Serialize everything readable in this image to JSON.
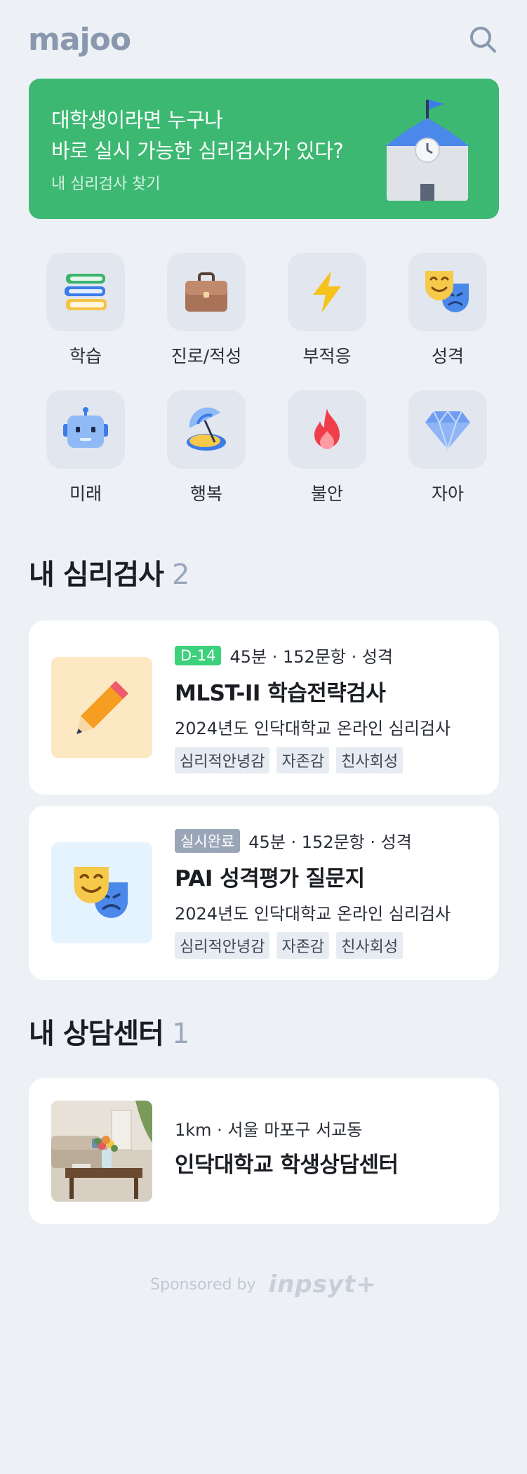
{
  "header": {
    "logo": "majoo",
    "search_icon": "search-icon"
  },
  "banner": {
    "line1": "대학생이라면 누구나",
    "line2": "바로 실시 가능한 심리검사가 있다?",
    "link": "내 심리검사 찾기",
    "color": "#3cb872",
    "illustration": "school-building-icon"
  },
  "categories": [
    {
      "label": "학습",
      "icon": "books-icon"
    },
    {
      "label": "진로/적성",
      "icon": "briefcase-icon"
    },
    {
      "label": "부적응",
      "icon": "lightning-icon"
    },
    {
      "label": "성격",
      "icon": "theater-masks-icon"
    },
    {
      "label": "미래",
      "icon": "robot-icon"
    },
    {
      "label": "행복",
      "icon": "beach-umbrella-icon"
    },
    {
      "label": "불안",
      "icon": "fire-icon"
    },
    {
      "label": "자아",
      "icon": "gem-icon"
    }
  ],
  "my_tests": {
    "title": "내 심리검사",
    "count": "2",
    "items": [
      {
        "badge": "D-14",
        "badge_color": "#3dd17c",
        "meta": "45분 · 152문항 · 성격",
        "title": "MLST-II 학습전략검사",
        "subtitle": "2024년도 인닥대학교 온라인 심리검사",
        "tags": [
          "심리적안녕감",
          "자존감",
          "친사회성"
        ],
        "icon": "pencil-icon"
      },
      {
        "badge": "실시완료",
        "badge_color": "#9aa6b8",
        "meta": "45분 · 152문항 · 성격",
        "title": "PAI 성격평가 질문지",
        "subtitle": "2024년도 인닥대학교 온라인 심리검사",
        "tags": [
          "심리적안녕감",
          "자존감",
          "친사회성"
        ],
        "icon": "theater-masks-icon"
      }
    ]
  },
  "my_centers": {
    "title": "내 상담센터",
    "count": "1",
    "items": [
      {
        "meta": "1km · 서울 마포구 서교동",
        "title": "인닥대학교 학생상담센터",
        "image": "counseling-room-photo"
      }
    ]
  },
  "sponsor": {
    "label": "Sponsored by",
    "brand": "inpsyt+"
  }
}
